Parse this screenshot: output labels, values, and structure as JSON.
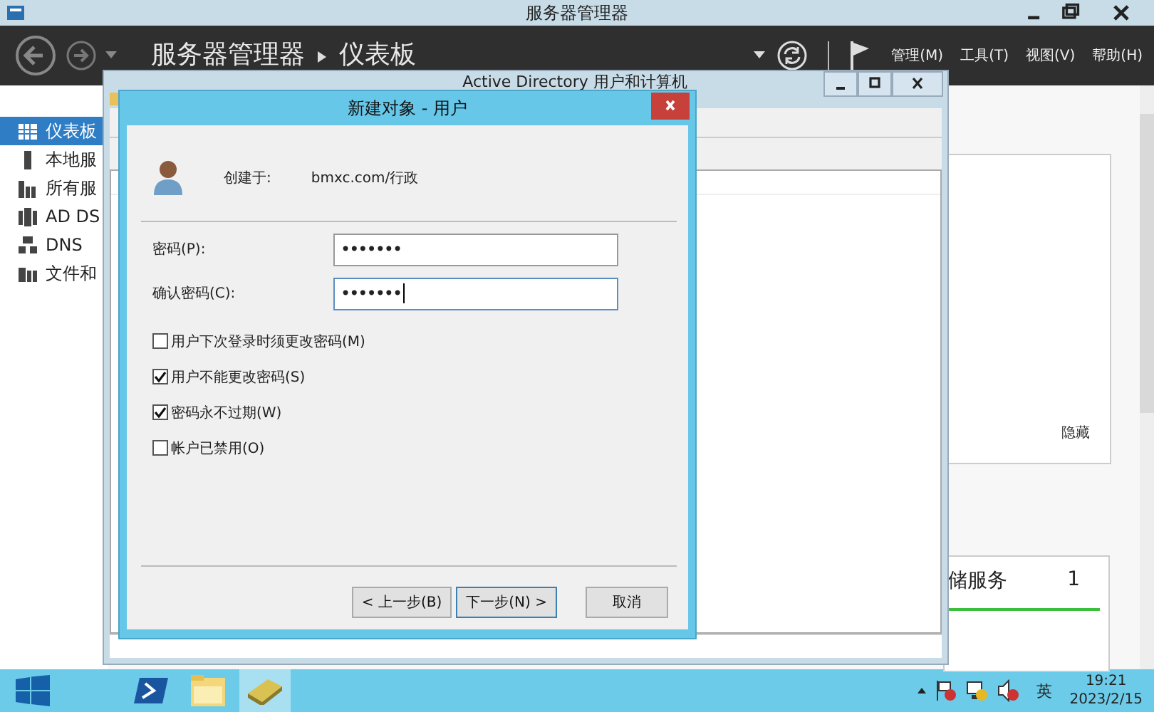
{
  "window": {
    "title": "服务器管理器"
  },
  "header": {
    "breadcrumb": [
      "服务器管理器",
      "仪表板"
    ],
    "menus": [
      "管理(M)",
      "工具(T)",
      "视图(V)",
      "帮助(H)"
    ]
  },
  "sidebar": {
    "items": [
      {
        "label": "仪表板",
        "selected": true,
        "kind": "grid"
      },
      {
        "label": "本地服",
        "selected": false,
        "kind": "server"
      },
      {
        "label": "所有服",
        "selected": false,
        "kind": "servers"
      },
      {
        "label": "AD DS",
        "selected": false,
        "kind": "ad"
      },
      {
        "label": "DNS",
        "selected": false,
        "kind": "dns"
      },
      {
        "label": "文件和",
        "selected": false,
        "kind": "files"
      }
    ]
  },
  "panel": {
    "hide_link": "隐藏"
  },
  "tile": {
    "title": "储服务",
    "count": "1"
  },
  "ad_window": {
    "title": "Active Directory 用户和计算机"
  },
  "dialog": {
    "title": "新建对象 - 用户",
    "created_in_label": "创建于:",
    "created_in_value": "bmxc.com/行政",
    "fields": [
      {
        "label": "密码(P):",
        "value": "•••••••",
        "focused": false
      },
      {
        "label": "确认密码(C):",
        "value": "•••••••",
        "focused": true
      }
    ],
    "checkboxes": [
      {
        "label": "用户下次登录时须更改密码(M)",
        "checked": false
      },
      {
        "label": "用户不能更改密码(S)",
        "checked": true
      },
      {
        "label": "密码永不过期(W)",
        "checked": true
      },
      {
        "label": "帐户已禁用(O)",
        "checked": false
      }
    ],
    "buttons": [
      {
        "label": "< 上一步(B)",
        "default": false
      },
      {
        "label": "下一步(N) >",
        "default": true
      },
      {
        "label": "取消",
        "default": false
      }
    ]
  },
  "taskbar": {
    "apps": [
      {
        "kind": "shell",
        "active": false
      },
      {
        "kind": "folder",
        "active": false
      },
      {
        "kind": "tool",
        "active": true
      }
    ],
    "language": "英",
    "time": "19:21",
    "date": "2023/2/15"
  }
}
